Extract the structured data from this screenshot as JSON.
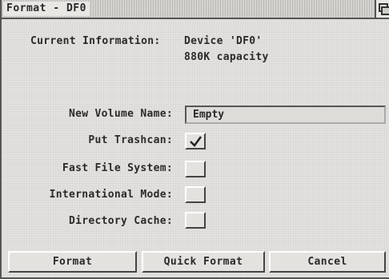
{
  "window": {
    "title": "Format - DF0"
  },
  "info": {
    "label": "Current Information:",
    "device": "Device 'DF0'",
    "capacity": "880K capacity"
  },
  "form": {
    "volume_name_label": "New Volume Name:",
    "volume_name_value": "Empty",
    "put_trashcan_label": "Put Trashcan:",
    "put_trashcan_checked": true,
    "ffs_label": "Fast File System:",
    "ffs_checked": false,
    "intl_label": "International Mode:",
    "intl_checked": false,
    "dircache_label": "Directory Cache:",
    "dircache_checked": false
  },
  "buttons": {
    "format": "Format",
    "quick_format": "Quick Format",
    "cancel": "Cancel"
  }
}
